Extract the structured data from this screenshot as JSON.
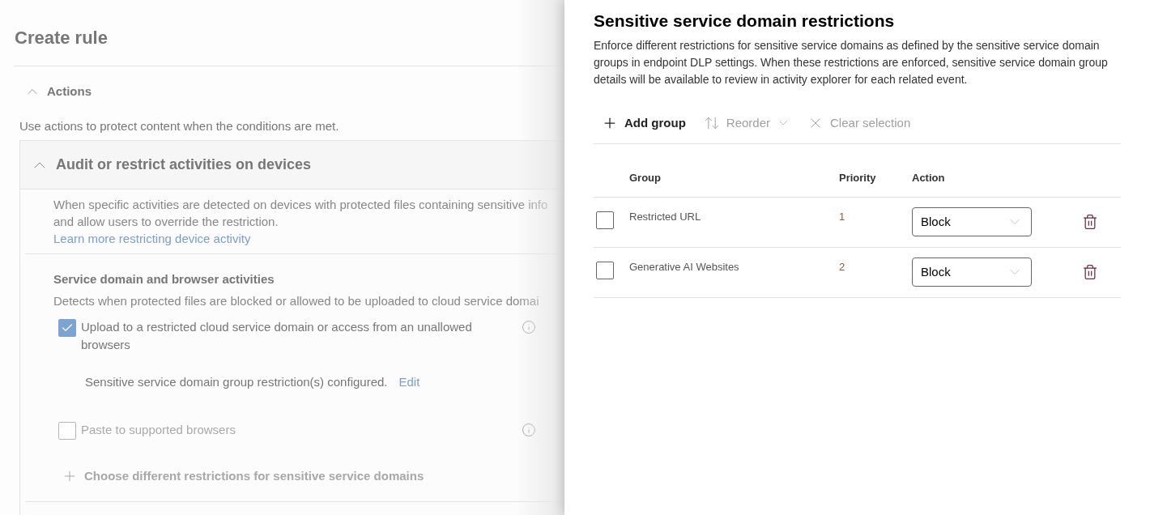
{
  "page": {
    "title": "Create rule"
  },
  "actions_section": {
    "title": "Actions",
    "expanded": true,
    "description": "Use actions to protect content when the conditions are met."
  },
  "card": {
    "title": "Audit or restrict activities on devices",
    "expanded": true,
    "description_lines": [
      "When specific activities are detected on devices with protected files containing sensitive info",
      "and allow users to override the restriction."
    ],
    "link": "Learn more restricting device activity",
    "subsection": {
      "title": "Service domain and browser activities",
      "description": "Detects when protected files are blocked or allowed to be uploaded to cloud service domai",
      "options": [
        {
          "label": "Upload to a restricted cloud service domain or access from an unallowed browsers",
          "checked": true,
          "disabled": false,
          "note": "Sensitive service domain group restriction(s) configured.",
          "note_link": "Edit"
        },
        {
          "label": "Paste to supported browsers",
          "checked": false,
          "disabled": true
        }
      ],
      "add_link": {
        "label": "Choose different restrictions for sensitive service domains",
        "disabled": true
      }
    }
  },
  "panel": {
    "title": "Sensitive service domain restrictions",
    "description": "Enforce different restrictions for sensitive service domains as defined by the sensitive service domain groups in endpoint DLP settings. When these restrictions are enforced, sensitive service domain group details will be available to review in activity explorer for each related event.",
    "toolbar": [
      {
        "kind": "add",
        "label": "Add group",
        "disabled": false
      },
      {
        "kind": "reorder",
        "label": "Reorder",
        "disabled": true
      },
      {
        "kind": "clear",
        "label": "Clear selection",
        "disabled": true
      }
    ],
    "columns": [
      "Group",
      "Priority",
      "Action"
    ],
    "rows": [
      {
        "group": "Restricted URL",
        "priority": "1",
        "action": "Block",
        "selected": false
      },
      {
        "group": "Generative AI Websites",
        "priority": "2",
        "action": "Block",
        "selected": false
      }
    ]
  }
}
